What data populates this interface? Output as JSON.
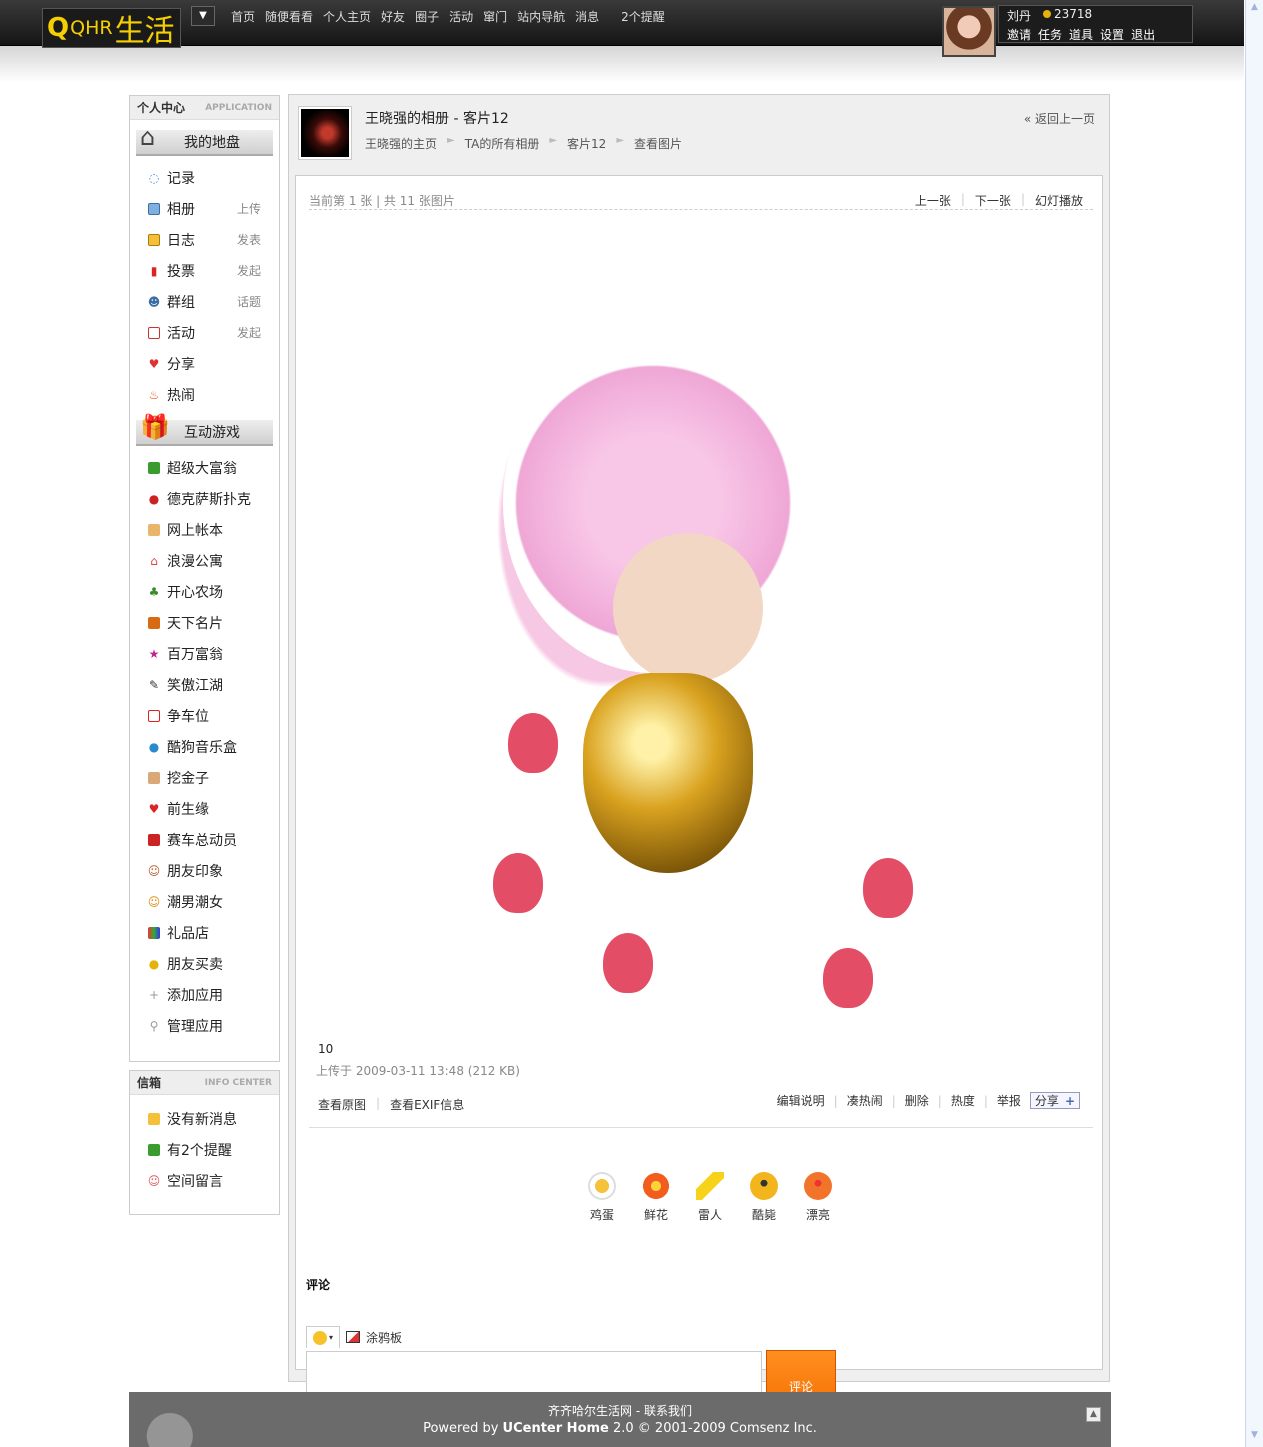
{
  "header": {
    "logo_q": "Q",
    "logo_qhr": "QHR",
    "logo_life": "生活",
    "menu_toggle": "▼",
    "nav": [
      "首页",
      "随便看看",
      "个人主页",
      "好友",
      "圈子",
      "活动",
      "窜门",
      "站内导航",
      "消息"
    ],
    "notice": "2个提醒",
    "user_name": "刘丹",
    "credits": "23718",
    "user_links": [
      "邀请",
      "任务",
      "道具",
      "设置",
      "退出"
    ]
  },
  "sidebar": {
    "head_title": "个人中心",
    "head_en": "APPLICATION",
    "section1": "我的地盘",
    "my_items": [
      {
        "label": "记录",
        "action": ""
      },
      {
        "label": "相册",
        "action": "上传"
      },
      {
        "label": "日志",
        "action": "发表"
      },
      {
        "label": "投票",
        "action": "发起"
      },
      {
        "label": "群组",
        "action": "话题"
      },
      {
        "label": "活动",
        "action": "发起"
      },
      {
        "label": "分享",
        "action": ""
      },
      {
        "label": "热闹",
        "action": ""
      }
    ],
    "section2": "互动游戏",
    "games": [
      "超级大富翁",
      "德克萨斯扑克",
      "网上帐本",
      "浪漫公寓",
      "开心农场",
      "天下名片",
      "百万富翁",
      "笑傲江湖",
      "争车位",
      "酷狗音乐盒",
      "挖金子",
      "前生缘",
      "赛车总动员",
      "朋友印象",
      "潮男潮女",
      "礼品店",
      "朋友买卖"
    ],
    "add_app": "添加应用",
    "manage_app": "管理应用",
    "info_title": "信箱",
    "info_en": "INFO CENTER",
    "info_items": [
      "没有新消息",
      "有2个提醒",
      "空间留言"
    ]
  },
  "main": {
    "album_title": "王晓强的相册  - 客片12",
    "crumbs": [
      "王晓强的主页",
      "TA的所有相册",
      "客片12",
      "查看图片"
    ],
    "back": "« 返回上一页",
    "count_text": "当前第  1 张  |  共  11 张图片",
    "pager": [
      "上一张",
      "下一张",
      "幻灯播放"
    ],
    "caption": "10",
    "meta": "上传于  2009-03-11 13:48 (212 KB)",
    "left_actions": [
      "查看原图",
      "查看EXIF信息"
    ],
    "right_actions": [
      "编辑说明",
      "凑热闹",
      "删除",
      "热度",
      "举报"
    ],
    "share": "分享",
    "reactions": [
      {
        "label": "鸡蛋",
        "color": "#f7c23b"
      },
      {
        "label": "鲜花",
        "color": "#f25c1e"
      },
      {
        "label": "雷人",
        "color": "#f7d21a"
      },
      {
        "label": "酷毙",
        "color": "#f2b51c"
      },
      {
        "label": "漂亮",
        "color": "#f2742b"
      }
    ],
    "comment_title": "评论",
    "doodle": "涂鸦板",
    "submit": "评论"
  },
  "footer": {
    "line1": "齐齐哈尔生活网  - 联系我们",
    "line2_pre": "Powered by ",
    "line2_brand": "UCenter Home",
    "line2_post": " 2.0 © 2001-2009 Comsenz Inc."
  },
  "colors": {
    "accent_orange": "#f46a00",
    "topbar": "#1c1c1c"
  }
}
